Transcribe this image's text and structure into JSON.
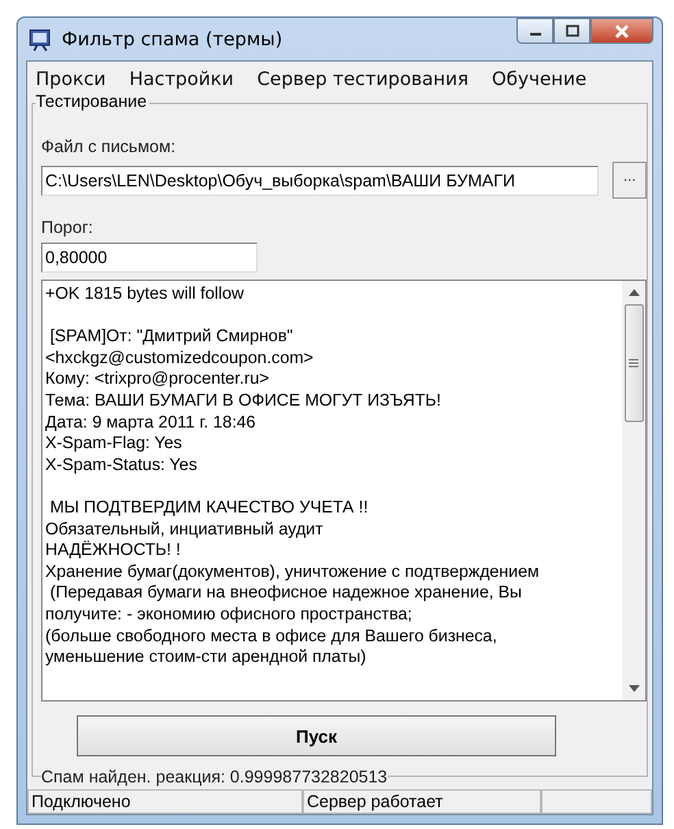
{
  "window": {
    "title": "Фильтр спама (термы)"
  },
  "menu": [
    {
      "label": "Прокси"
    },
    {
      "label": "Настройки"
    },
    {
      "label": "Сервер тестирования"
    },
    {
      "label": "Обучение"
    }
  ],
  "group": {
    "title": "Тестирование",
    "file_label": "Файл с письмом:",
    "file_value": "C:\\Users\\LEN\\Desktop\\Обуч_выборка\\spam\\ВАШИ БУМАГИ",
    "browse_button": "...",
    "threshold_label": "Порог:",
    "threshold_value": "0,80000",
    "message": [
      {
        "lines": [
          "+OK 1815 bytes will follow"
        ]
      },
      {
        "lines": [
          " [SPAM]От: \"Дмитрий Смирнов\"",
          "<hxckgz@customizedcoupon.com>",
          "Кому: <trixpro@procenter.ru>",
          "Тема: ВАШИ БУМАГИ В ОФИСЕ МОГУТ ИЗЪЯТЬ!",
          "Дата: 9 марта 2011 г. 18:46",
          "X-Spam-Flag: Yes",
          "X-Spam-Status: Yes"
        ]
      },
      {
        "lines": [
          " МЫ ПОДТВЕРДИМ КАЧЕСТВО УЧЕТА !!",
          "Обязательный, инциативный аудит",
          "НАДЁЖНОСТЬ! !",
          "Хранение бумаг(документов), уничтожение с подтверждением",
          " (Передавая бумаги на внеофисное надежное хранение, Вы",
          "получите: - экономию офисного пространства;",
          "(больше свободного места в офисе для Вашего бизнеса,",
          "уменьшение стоим-сти арендной платы)"
        ]
      }
    ],
    "start_button": "Пуск",
    "result": "Спам найден. реакция: 0.999987732820513"
  },
  "status_bar": [
    {
      "text": "Подключено"
    },
    {
      "text": "Сервер работает"
    }
  ]
}
